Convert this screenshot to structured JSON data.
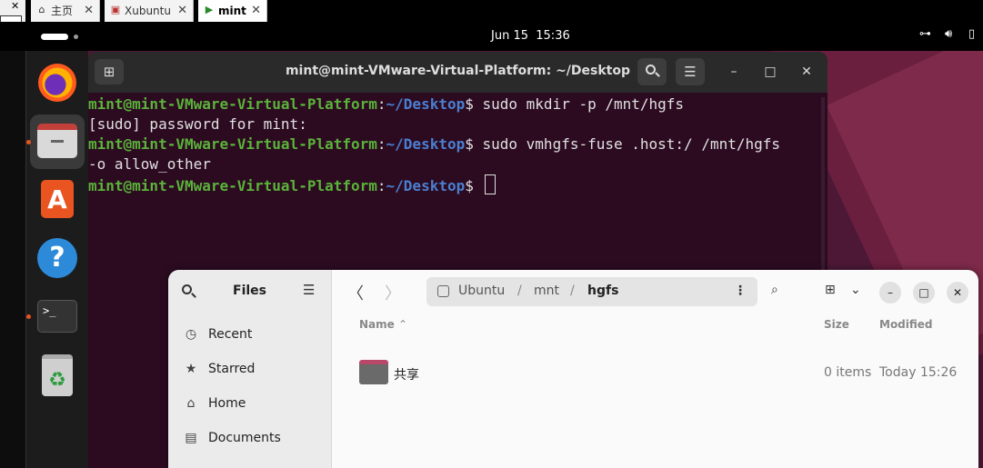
{
  "host_tabs": [
    {
      "icon": "home-icon",
      "label": "主页"
    },
    {
      "icon": "vm-icon",
      "label": "Xubuntu"
    },
    {
      "icon": "vm-running-icon",
      "label": "mint"
    }
  ],
  "host_close_glyph": "✕",
  "topbar": {
    "date": "Jun 15",
    "time": "15:36"
  },
  "terminal": {
    "title": "mint@mint-VMware-Virtual-Platform: ~/Desktop",
    "new_tab_glyph": "⊞",
    "menu_glyph": "☰",
    "minimize_glyph": "–",
    "maximize_glyph": "□",
    "close_glyph": "✕",
    "prompt_user": "mint@mint-VMware-Virtual-Platform",
    "prompt_colon": ":",
    "prompt_path": "~/Desktop",
    "prompt_dollar": "$ ",
    "lines": [
      {
        "type": "cmd",
        "text": "sudo mkdir -p /mnt/hgfs"
      },
      {
        "type": "out",
        "text": "[sudo] password for mint:"
      },
      {
        "type": "cmd",
        "text": "sudo vmhgfs-fuse .host:/ /mnt/hgfs"
      },
      {
        "type": "out",
        "text": "-o allow_other"
      },
      {
        "type": "cmd",
        "text": ""
      }
    ]
  },
  "files": {
    "title": "Files",
    "sidebar": [
      {
        "icon": "clock-icon",
        "glyph": "◷",
        "label": "Recent"
      },
      {
        "icon": "star-icon",
        "glyph": "★",
        "label": "Starred"
      },
      {
        "icon": "home-icon",
        "glyph": "⌂",
        "label": "Home"
      },
      {
        "icon": "document-icon",
        "glyph": "▤",
        "label": "Documents"
      }
    ],
    "path": [
      "Ubuntu",
      "mnt",
      "hgfs"
    ],
    "path_separator": "/",
    "columns": {
      "name": "Name",
      "size": "Size",
      "modified": "Modified"
    },
    "rows": [
      {
        "name": "共享",
        "size": "0 items",
        "modified": "Today 15:26"
      }
    ]
  },
  "dock": [
    "Firefox",
    "Files",
    "App Center",
    "Help",
    "Terminal",
    "Trash"
  ],
  "colors": {
    "accent": "#e95420",
    "terminal_bg": "#2c0b21",
    "prompt_user": "#5ab33a",
    "prompt_path": "#4a7fd0"
  }
}
